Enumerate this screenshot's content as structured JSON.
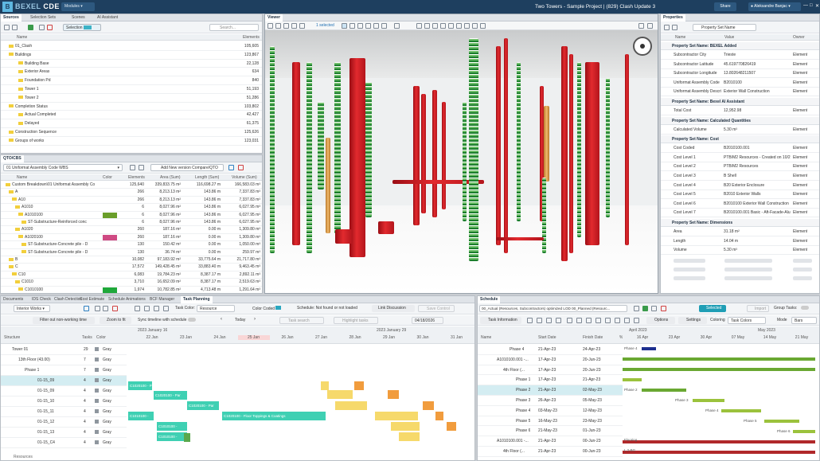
{
  "app": {
    "logo_mark": "B",
    "logo_text": "BEXEL",
    "logo_suffix": "CDE",
    "modules": "Modules",
    "title": "Two Towers - Sample Project | (829) Clash Update 3",
    "share": "Share",
    "user": "Aleksandre Banjac",
    "win_min": "—",
    "win_max": "□",
    "win_close": "✕"
  },
  "sources_panel": {
    "tabs": [
      "Sources",
      "Selection Sets",
      "Scenes",
      "AI Assistant"
    ],
    "selection_label": "Selection",
    "search_placeholder": "Search...",
    "col_name": "Name",
    "col_elements": "Elements",
    "rows": [
      {
        "name": "01_Clash",
        "count": "105,605"
      },
      {
        "name": "Buildings",
        "count": "123,867"
      },
      {
        "name": "Building Base",
        "count": "22,128"
      },
      {
        "name": "Exterior Areas",
        "count": "634"
      },
      {
        "name": "Foundation Pd",
        "count": "840"
      },
      {
        "name": "Tower 1",
        "count": "51,193"
      },
      {
        "name": "Tower 2",
        "count": "51,286"
      },
      {
        "name": "Completion Status",
        "count": "103,802"
      },
      {
        "name": "Actual Completed",
        "count": "42,427"
      },
      {
        "name": "Delayed",
        "count": "61,375"
      },
      {
        "name": "Construction Sequence",
        "count": "125,626"
      },
      {
        "name": "Groups of works",
        "count": "123,031"
      }
    ]
  },
  "qto_panel": {
    "title": "QTO/CBS",
    "dropdown": "01 Uniformat Assembly Code WBS",
    "add_button": "Add New version Compare/QTO",
    "cols": [
      "Name",
      "Color",
      "Elements",
      "Area (Sum)",
      "Length (Sum)",
      "Volume (Sum)"
    ],
    "rows": [
      {
        "name": "Custom Breakdown\\01 Uniformat Assembly Co",
        "color": "",
        "el": "125,640",
        "area": "339,833.75 m²",
        "len": "116,698.27 m",
        "vol": "166,583.03 m³"
      },
      {
        "name": "A",
        "color": "",
        "el": "266",
        "area": "8,213.13 m²",
        "len": "143.86 m",
        "vol": "7,337.83 m³"
      },
      {
        "name": "A10",
        "color": "",
        "el": "266",
        "area": "8,213.13 m²",
        "len": "143.86 m",
        "vol": "7,337.83 m³"
      },
      {
        "name": "A1010",
        "color": "",
        "el": "6",
        "area": "8,027.96 m²",
        "len": "143.86 m",
        "vol": "6,027.95 m³"
      },
      {
        "name": "A1010100",
        "color": "#6a9e2a",
        "el": "6",
        "area": "8,027.96 m²",
        "len": "143.86 m",
        "vol": "6,027.95 m³"
      },
      {
        "name": "ST-Substructure-Reinforced conc",
        "color": "",
        "el": "6",
        "area": "8,027.96 m²",
        "len": "143.86 m",
        "vol": "6,027.95 m³"
      },
      {
        "name": "A1020",
        "color": "",
        "el": "260",
        "area": "187.16 m²",
        "len": "0.00 m",
        "vol": "1,309.80 m³"
      },
      {
        "name": "A1020100",
        "color": "#cf4a83",
        "el": "260",
        "area": "187.16 m²",
        "len": "0.00 m",
        "vol": "1,309.80 m³"
      },
      {
        "name": "ST-Substructure-Concrete pile - D",
        "color": "",
        "el": "130",
        "area": "150.42 m²",
        "len": "0.00 m",
        "vol": "1,050.00 m³"
      },
      {
        "name": "ST-Substructure-Concrete pile - D",
        "color": "",
        "el": "130",
        "area": "36.74 m²",
        "len": "0.00 m",
        "vol": "259.97 m³"
      },
      {
        "name": "B",
        "color": "",
        "el": "10,082",
        "area": "97,183.92 m²",
        "len": "33,775.64 m",
        "vol": "21,717.80 m³"
      },
      {
        "name": "C",
        "color": "",
        "el": "17,572",
        "area": "149,428.45 m²",
        "len": "33,883.40 m",
        "vol": "9,463.45 m³"
      },
      {
        "name": "C10",
        "color": "",
        "el": "6,083",
        "area": "19,784.23 m²",
        "len": "8,387.17 m",
        "vol": "2,892.11 m³"
      },
      {
        "name": "C1010",
        "color": "",
        "el": "3,710",
        "area": "16,652.09 m²",
        "len": "8,387.17 m",
        "vol": "2,519.63 m³"
      },
      {
        "name": "C1010100",
        "color": "#1fa83a",
        "el": "1,974",
        "area": "10,782.85 m²",
        "len": "4,713.48 m",
        "vol": "1,291.64 m³"
      }
    ]
  },
  "viewer": {
    "tab": "Viewer",
    "selected": "1 selected"
  },
  "properties": {
    "tab": "Properties",
    "dropdown": "Property Set Name",
    "cols": [
      "Name",
      "Value",
      "Owner"
    ],
    "sections": [
      {
        "title": "Property Set Name: BEXEL Added",
        "rows": [
          [
            "Subcontractor City",
            "Trieste",
            "Element"
          ],
          [
            "Subcontractor Latitude",
            "45.619770826419",
            "Element"
          ],
          [
            "Subcontractor Longitude",
            "13.802648211507",
            "Element"
          ],
          [
            "Uniformat Assembly Code",
            "B2010100",
            "Element"
          ],
          [
            "Uniformat Assembly Descri",
            "Exterior Wall Construction",
            "Element"
          ]
        ]
      },
      {
        "title": "Property Set Name: Bexel AI Assistant",
        "rows": [
          [
            "Total Cost",
            "12,952.98",
            "Element"
          ]
        ]
      },
      {
        "title": "Property Set Name: Calculated Quantities",
        "rows": [
          [
            "Calculated Volume",
            "5.30 m³",
            "Element"
          ]
        ]
      },
      {
        "title": "Property Set Name: Cost",
        "rows": [
          [
            "Cost Coded",
            "B2010100.001",
            "Element"
          ],
          [
            "Cost Level 1",
            "PTB/M2 Resources - Created on 10/2",
            "Element"
          ],
          [
            "Cost Level 2",
            "PTB/M2 Resources",
            "Element"
          ],
          [
            "Cost Level 3",
            "B Shell",
            "Element"
          ],
          [
            "Cost Level 4",
            "B20 Exterior Enclosure",
            "Element"
          ],
          [
            "Cost Level 5",
            "B2010 Exterior Walls",
            "Element"
          ],
          [
            "Cost Level 6",
            "B2010100 Exterior Wall Construction",
            "Element"
          ],
          [
            "Cost Level 7",
            "B2010100.001 Basic - Aft-Facade-Alu",
            "Element"
          ]
        ]
      },
      {
        "title": "Property Set Name: Dimensions",
        "rows": [
          [
            "Area",
            "31.18 m²",
            "Element"
          ],
          [
            "Length",
            "14.04 m",
            "Element"
          ],
          [
            "Volume",
            "5.30 m³",
            "Element"
          ]
        ]
      }
    ]
  },
  "task_panel": {
    "tabs": [
      "Documents",
      "IDS Check",
      "Clash Detection",
      "Cost Estimate",
      "Schedule Animations",
      "BCF Manager",
      "Task Planning"
    ],
    "view": "Interior Works",
    "task_color_label": "Task Color:",
    "task_color": "Resource",
    "color_coded": "Color Coded",
    "schedule_status": "Schedule: Not found or not loaded",
    "link_discussion": "Link Discussion",
    "save_control": "Save Control",
    "filter_btn": "Filter out non-working time",
    "zoom_btn": "Zoom to fit",
    "sync_btn": "Sync timeline with schedule",
    "today": "Today",
    "task_search": "Task search",
    "highlight": "Highlight tasks",
    "date": "04/18/2026",
    "week1": "2023 January 16",
    "week2": "2023 January 29",
    "days": [
      "22 Jan",
      "23 Jan",
      "24 Jan",
      "25 Jan",
      "26 Jan",
      "27 Jan",
      "28 Jan",
      "29 Jan",
      "30 Jan",
      "31 Jan"
    ],
    "cols": [
      "Structure",
      "Tasks",
      "Color"
    ],
    "rows": [
      {
        "name": "Tower 01",
        "tasks": "29",
        "color": "Gray"
      },
      {
        "name": "13th Floor (43.00)",
        "tasks": "7",
        "color": "Gray"
      },
      {
        "name": "Phase 1",
        "tasks": "7",
        "color": "Gray"
      },
      {
        "name": "01-15_09",
        "tasks": "4",
        "color": "Gray"
      },
      {
        "name": "01-15_09",
        "tasks": "4",
        "color": "Gray"
      },
      {
        "name": "01-15_10",
        "tasks": "4",
        "color": "Gray"
      },
      {
        "name": "01-15_11",
        "tasks": "4",
        "color": "Gray"
      },
      {
        "name": "01-15_12",
        "tasks": "4",
        "color": "Gray"
      },
      {
        "name": "01-15_13",
        "tasks": "4",
        "color": "Gray"
      },
      {
        "name": "01-15_C4",
        "tasks": "4",
        "color": "Gray"
      }
    ],
    "bars": [
      "C1020100 - Par",
      "C1020100 - Par",
      "C1020100 - Par",
      "C1010100 -",
      "C1010100 -",
      "C1020100 - Floor Toppings & Coatings",
      "C1010100 -"
    ],
    "footer": "Resources"
  },
  "schedule_panel": {
    "tab": "Schedule",
    "file": "00_Actual (Resources, Subcontractors) optimized LOD 00_Planned (Resourc...",
    "selected": "Selected",
    "import": "Import",
    "group_tasks": "Group Tasks:",
    "task_info": "Task Information",
    "options": "Options",
    "settings": "Settings",
    "coloring": "Coloring",
    "task_colors": "Task Colors",
    "mode": "Mode",
    "mode_val": "Bars",
    "cols": [
      "Name",
      "Start Date",
      "Finish Date",
      "%"
    ],
    "months": [
      "April 2023",
      "May 2023"
    ],
    "days": [
      "16 Apr",
      "23 Apr",
      "30 Apr",
      "07 May",
      "14 May",
      "21 May"
    ],
    "rows": [
      {
        "name": "Phase 4",
        "start": "21-Apr-23",
        "finish": "24-Apr-23"
      },
      {
        "name": "A1010100.001 -...",
        "start": "17-Apr-23",
        "finish": "20-Jun-23"
      },
      {
        "name": "4th Floor (...",
        "start": "17-Apr-23",
        "finish": "20-Jun-23"
      },
      {
        "name": "Phase 1",
        "start": "17-Apr-23",
        "finish": "21-Apr-23"
      },
      {
        "name": "Phase 2",
        "start": "21-Apr-23",
        "finish": "02-May-23"
      },
      {
        "name": "Phase 3",
        "start": "26-Apr-23",
        "finish": "05-May-23"
      },
      {
        "name": "Phase 4",
        "start": "03-May-23",
        "finish": "12-May-23"
      },
      {
        "name": "Phase 5",
        "start": "16-May-23",
        "finish": "23-May-23"
      },
      {
        "name": "Phase 6",
        "start": "21-May-23",
        "finish": "01-Jun-23"
      },
      {
        "name": "A1010100.001 -...",
        "start": "21-Apr-23",
        "finish": "00-Jun-23"
      },
      {
        "name": "4th Floor (...",
        "start": "21-Apr-23",
        "finish": "00-Jun-23"
      }
    ],
    "gantt_labels": [
      "Phase 4",
      "Phase 2",
      "Phase 3",
      "Phase 4",
      "Phase 5",
      "Phase 6",
      "Flooring",
      "L 2-BG"
    ]
  }
}
